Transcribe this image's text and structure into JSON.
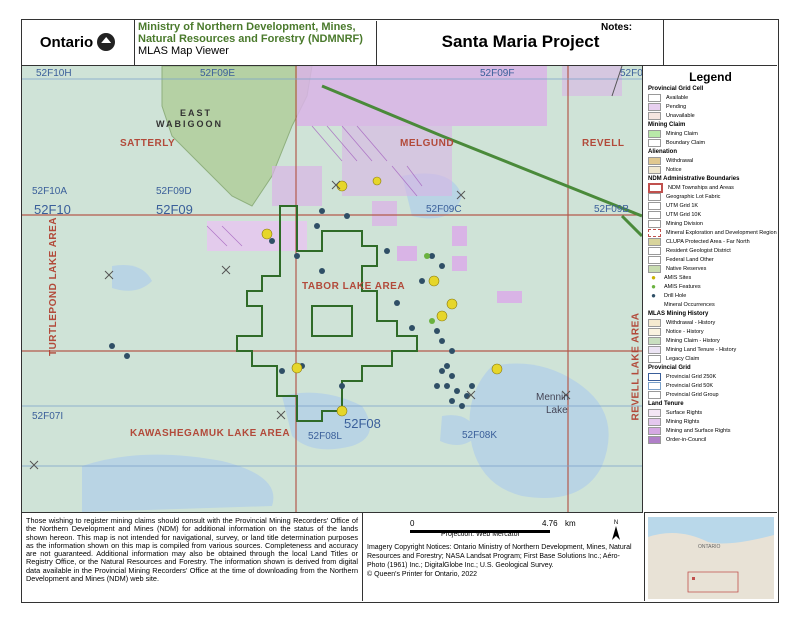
{
  "header": {
    "logo_text": "Ontario",
    "ministry_name": "Ministry of Northern Development, Mines, Natural Resources and Forestry (NDMNRF)",
    "viewer": "MLAS Map Viewer",
    "title": "Santa Maria Project",
    "notes_label": "Notes:"
  },
  "map": {
    "grid_labels": [
      "52F10H",
      "52F09E",
      "52F09F",
      "52F09",
      "52F10A",
      "52F09D",
      "52F10",
      "52F09",
      "52F09C",
      "52F09B",
      "52F07I",
      "52F08L",
      "52F08",
      "52F08K"
    ],
    "township_labels": [
      "SATTERLY",
      "MELGUND",
      "REVELL",
      "TABOR LAKE AREA",
      "KAWASHEGAMUK LAKE AREA",
      "TURTLEPOND LAKE AREA",
      "REVELL LAKE AREA"
    ],
    "reserve_label": [
      "EAST",
      "WABIGOON"
    ],
    "lake_label": [
      "Mennin",
      "Lake"
    ]
  },
  "legend": {
    "title": "Legend",
    "sections": [
      {
        "heading": "Provincial Grid Cell",
        "items": [
          "Available",
          "Pending",
          "Unavailable"
        ]
      },
      {
        "heading": "Mining Claim",
        "items": [
          "Mining Claim",
          "Boundary Claim"
        ]
      },
      {
        "heading": "Alienation",
        "items": [
          "Withdrawal",
          "Notice"
        ]
      },
      {
        "heading": "NDM Administrative Boundaries",
        "items": [
          "NDM Townships and Areas",
          "Geographic Lot Fabric",
          "UTM Grid 1K",
          "UTM Grid 10K",
          "Mining Division",
          "Mineral Exploration and Development Region",
          "CLUPA Protected Area - Far North",
          "Resident Geologist District",
          "Federal Land Other",
          "Native Reserves",
          "AMIS Sites",
          "AMIS Features",
          "Drill Hole",
          "Mineral Occurrences"
        ]
      },
      {
        "heading": "MLAS Mining History",
        "items": [
          "Withdrawal - History",
          "Notice - History",
          "Mining Claim - History",
          "Mining Land Tenure - History",
          "Legacy Claim"
        ]
      },
      {
        "heading": "Provincial Grid",
        "items": [
          "Provincial Grid 250K",
          "Provincial Grid 50K",
          "Provincial Grid Group"
        ]
      },
      {
        "heading": "Land Tenure",
        "items": [
          "Surface Rights",
          "Mining Rights",
          "Mining and Surface Rights",
          "Order-in-Council"
        ]
      }
    ],
    "swatch_colors": {
      "available": "#ffffff",
      "pending": "#e8d0f0",
      "unavailable": "#f5e6e0",
      "mining_claim": "#b8e8a8",
      "withdrawal": "#e0c890",
      "notice": "#f0e8d0",
      "townships": "#c0504d",
      "native": "#c8dcb0",
      "surface": "#f3e6f5",
      "mining_rights": "#e4c8ee",
      "mining_surface": "#d5a8e3",
      "oic": "#b07fc8"
    }
  },
  "footer": {
    "disclaimer": "Those wishing to register mining claims should consult with the Provincial Mining Recorders' Office of the Northern Development and Mines (NDM) for additional information on the status of the lands shown hereon. This map is not intended for navigational, survey, or land title determination purposes as the information shown on this map is compiled from various sources. Completeness and accuracy are not guaranteed. Additional information may also be obtained through the local Land Titles or Registry Office, or the Natural Resources and Forestry. The information shown is derived from digital data available in the Provincial Mining Recorders' Office at the time of downloading from the Northern Development and Mines (NDM) web site.",
    "scale_start": "0",
    "scale_end": "4.76",
    "scale_unit": "km",
    "projection": "Projection: Web Mercator",
    "imagery": "Imagery Copyright Notices: Ontario Ministry of Northern Development, Mines, Natural Resources and Forestry; NASA Landsat Program; First Base Solutions Inc.; Aéro-Photo (1961) Inc.; DigitalGlobe Inc.; U.S. Geological Survey.",
    "copyright": "© Queen's Printer for Ontario, 2022",
    "north": "N",
    "inset_label": "ONTARIO"
  }
}
